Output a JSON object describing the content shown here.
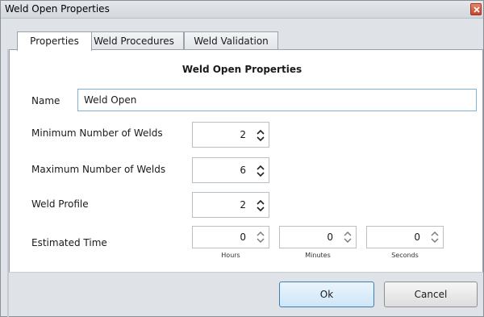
{
  "window": {
    "title": "Weld Open Properties"
  },
  "tabs": [
    "Properties",
    "Weld Procedures",
    "Weld Validation"
  ],
  "form": {
    "heading": "Weld Open Properties",
    "name_label": "Name",
    "name_value": "Weld Open",
    "min_welds_label": "Minimum Number of Welds",
    "min_welds_value": "2",
    "max_welds_label": "Maximum Number of Welds",
    "max_welds_value": "6",
    "profile_label": "Weld Profile",
    "profile_value": "2",
    "time_label": "Estimated Time",
    "hours_value": "0",
    "minutes_value": "0",
    "seconds_value": "0",
    "hours_label": "Hours",
    "minutes_label": "Minutes",
    "seconds_label": "Seconds"
  },
  "buttons": {
    "ok": "Ok",
    "cancel": "Cancel"
  },
  "colors": {
    "accent": "#3c7fb1",
    "focus_border": "#7fb0e0",
    "close": "#c7452a"
  }
}
